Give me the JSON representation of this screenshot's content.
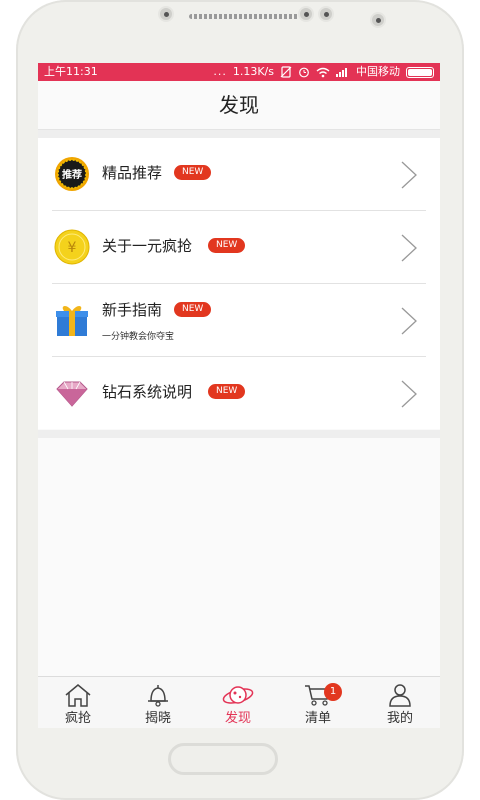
{
  "status_bar": {
    "time": "上午11:31",
    "dots": "...",
    "speed": "1.13K/s",
    "carrier": "中国移动",
    "bar_color": "#e33355",
    "icons": [
      "no-sim-icon",
      "alarm-icon",
      "wifi-icon",
      "signal-icon",
      "battery-icon"
    ]
  },
  "header": {
    "title": "发现"
  },
  "list": {
    "items": [
      {
        "title": "精品推荐",
        "badge": "NEW",
        "icon": "recommend-seal-icon",
        "icon_text": "推荐"
      },
      {
        "title": "关于一元疯抢",
        "badge": "NEW",
        "icon": "yuan-coin-icon",
        "icon_text": "¥"
      },
      {
        "title": "新手指南",
        "badge": "NEW",
        "subtitle": "一分钟教会你夺宝",
        "icon": "gift-box-icon"
      },
      {
        "title": "钻石系统说明",
        "badge": "NEW",
        "icon": "diamond-icon"
      }
    ]
  },
  "tabbar": {
    "active_color": "#e33355",
    "tabs": [
      {
        "label": "疯抢",
        "icon": "home-icon"
      },
      {
        "label": "揭晓",
        "icon": "bell-icon"
      },
      {
        "label": "发现",
        "icon": "planet-icon",
        "active": true
      },
      {
        "label": "清单",
        "icon": "cart-icon",
        "badge": "1"
      },
      {
        "label": "我的",
        "icon": "person-icon"
      }
    ]
  }
}
